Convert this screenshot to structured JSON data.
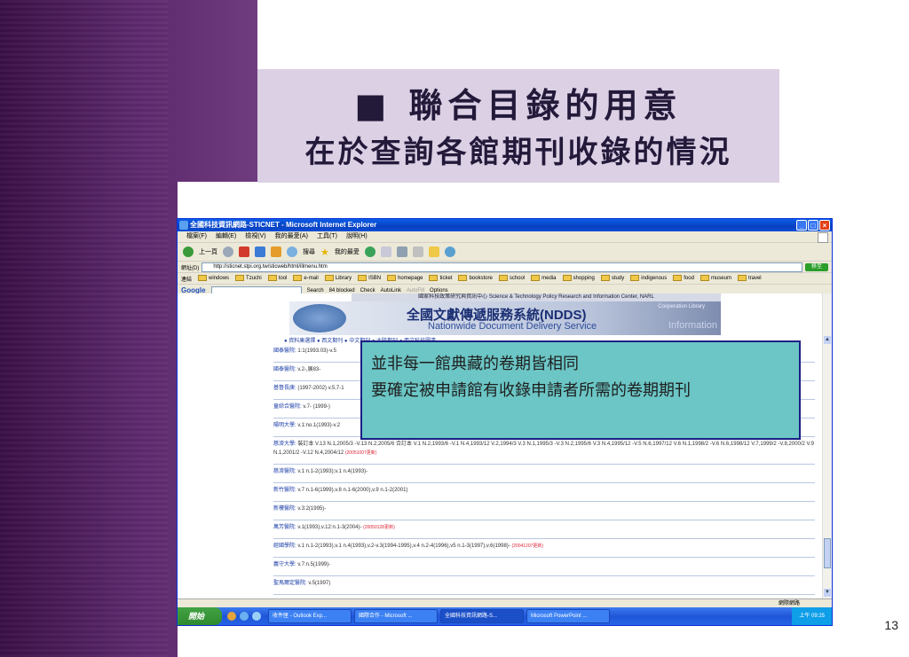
{
  "slide": {
    "title_line1": "■ 聯合目錄的用意",
    "title_line2": "在於查詢各館期刊收錄的情況",
    "page_number": "13"
  },
  "window": {
    "title": "全國科技資訊網路-STICNET - Microsoft Internet Explorer",
    "controls": [
      "_",
      "□",
      "×"
    ]
  },
  "menubar": [
    "檔案(F)",
    "編輯(E)",
    "檢視(V)",
    "我的最愛(A)",
    "工具(T)",
    "說明(H)"
  ],
  "toolbar": {
    "back": "上一頁",
    "search": "搜尋",
    "favorites": "我的最愛"
  },
  "address": {
    "label": "網址(D)",
    "url": "http://sticnet.stpi.org.tw/sticweb/html/illmenu.htm",
    "go": "移至"
  },
  "links": {
    "label": "連結",
    "items": [
      "windows",
      "Tzuchi",
      "tool",
      "e-mail",
      "Library",
      "ISBN",
      "homepage",
      "ticket",
      "bookstore",
      "school",
      "media",
      "shopping",
      "study",
      "indigenous",
      "food",
      "museum",
      "travel"
    ]
  },
  "googlebar": {
    "logo": "Google",
    "search": "Search",
    "blocked": "84 blocked",
    "check": "Check",
    "autolink": "AutoLink",
    "autofill": "AutoFill",
    "options": "Options"
  },
  "page": {
    "banner_strip": "國家科技政策研究與資訊中心 Science & Technology Policy Research and Information Center, NARL",
    "banner_zh": "全國文獻傳遞服務系統(NDDS)",
    "banner_en": "Nationwide Document Delivery Service",
    "banner_corp": "Cooperation Library",
    "banner_info": "Information",
    "nav": "● 資料庫選擇 ● 西文期刊 ● 中文期刊 ● 大陸期刊 ● 西文科技圖書",
    "rows": [
      {
        "name": "國泰醫院:",
        "holding": "1:1(1993.03)-v.5",
        "update": ""
      },
      {
        "name": "國泰醫院:",
        "holding": "v.2-,展83-",
        "update": ""
      },
      {
        "name": "基督長庚:",
        "holding": "(1997-2002) v.5,7-1",
        "update": ""
      },
      {
        "name": "童綜合醫院:",
        "holding": "v.7- (1999-)",
        "update": ""
      },
      {
        "name": "陽明大學:",
        "holding": "v.1:no.1(1993)-v.2",
        "update": ""
      },
      {
        "name": "慈濟大學:",
        "holding": "裝訂本 V.13 N.1,2005/3 -V.13 N.2,2005/6 合訂本 V.1 N.2,1993/6 -V.1 N.4,1993/12 V.2,1994/3 V.3 N.1,1995/3 -V.3 N.2,1995/6 V.3 N.4,1995/12 -V.5 N.6,1997/12 V.6 N.1,1998/2 -V.6 N.6,1998/12 V.7,1999/2 -V.8,2000/2 V.9 N.1,2001/2 -V.12 N.4,2004/12",
        "update": "(20051007更新)"
      },
      {
        "name": "慈濟醫院:",
        "holding": "v.1 n.1-2(1993);v.1 n.4(1993)-",
        "update": ""
      },
      {
        "name": "新竹醫院:",
        "holding": "v.7 n.1-6(1999),v.8 n.1-6(2000),v.9 n.1-2(2001)",
        "update": ""
      },
      {
        "name": "新樓醫院:",
        "holding": "v.3:2(1995)-",
        "update": ""
      },
      {
        "name": "萬芳醫院:",
        "holding": "v.1(1993),v.12:n.1-3(2004)-",
        "update": "(20050128更新)"
      },
      {
        "name": "經國學院:",
        "holding": "v.1 n.1-2(1993),v.1 n.4(1993),v.2-v.3(1994-1995),v.4 n.2-4(1996),v5 n.1-3(1997),v.6(1998)-",
        "update": "(20041207更新)"
      },
      {
        "name": "義守大學:",
        "holding": "v.7:n.5(1999)-",
        "update": ""
      },
      {
        "name": "聖馬爾定醫院:",
        "holding": "v.5(1997)",
        "update": ""
      }
    ]
  },
  "statusbar": {
    "zone": "網際網路"
  },
  "taskbar": {
    "start": "開始",
    "tasks": [
      "收件匣 - Outlook Exp...",
      "國際合作 - Microsoft ...",
      "全國科技資訊網路-S...",
      "Microsoft PowerPoint ..."
    ],
    "clock": "上午 09:25"
  },
  "callout": {
    "line1": "並非每一館典藏的卷期皆相同",
    "line2": "要確定被申請館有收錄申請者所需的卷期期刊"
  }
}
